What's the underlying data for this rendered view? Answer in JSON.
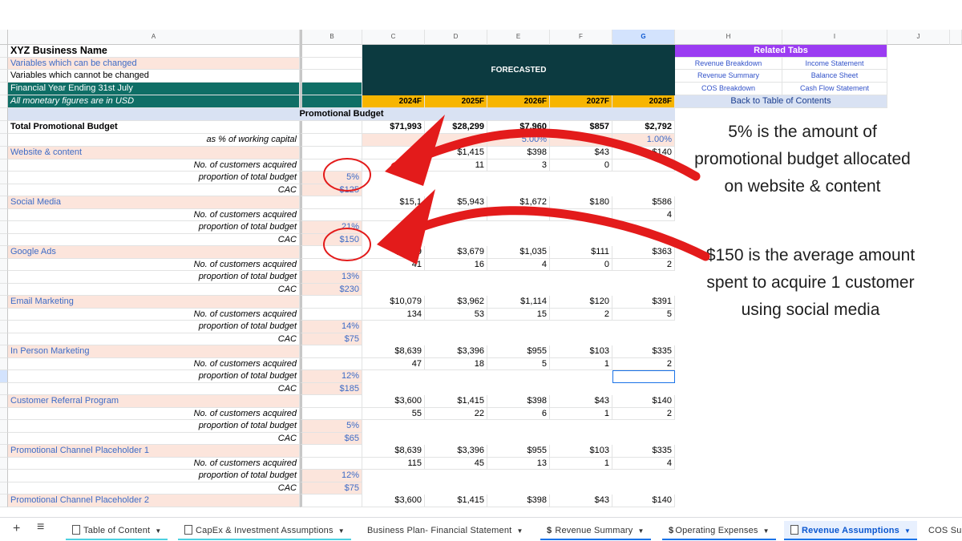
{
  "columns": [
    "A",
    "B",
    "C",
    "D",
    "E",
    "F",
    "G",
    "H",
    "I",
    "J"
  ],
  "sheet": {
    "business_name": "XYZ Business Name",
    "var_changeable": "Variables which can be changed",
    "var_fixed": "Variables which cannot be changed",
    "fy_ending": "Financial Year Ending 31st July",
    "currency_note": "All monetary figures are in USD",
    "forecasted": "FORECASTED",
    "years": [
      "2024F",
      "2025F",
      "2026F",
      "2027F",
      "2028F"
    ],
    "section_title": "Promotional Budget",
    "total_label": "Total Promotional Budget",
    "total_values": [
      "$71,993",
      "$28,299",
      "$7,960",
      "$857",
      "$2,792"
    ],
    "pct_label": "as % of working capital",
    "pct_values": [
      "",
      "",
      "5.00%",
      "",
      "1.00%"
    ],
    "related_title": "Related Tabs",
    "links": [
      [
        "Revenue Breakdown",
        "Income Statement"
      ],
      [
        "Revenue Summary",
        "Balance Sheet"
      ],
      [
        "COS Breakdown",
        "Cash Flow Statement"
      ]
    ],
    "back_link": "Back to Table of Contents",
    "sub_labels": {
      "customers": "No. of customers acquired",
      "proportion": "proportion of total budget",
      "cac": "CAC"
    },
    "channels": [
      {
        "name": "Website & content",
        "budget": [
          "",
          "$1,415",
          "$398",
          "$43",
          "$140"
        ],
        "customers": [
          "",
          "11",
          "3",
          "0",
          ""
        ],
        "proportion": "5%",
        "cac": "$125"
      },
      {
        "name": "Social Media",
        "budget": [
          "$15,1",
          "$5,943",
          "$1,672",
          "$180",
          "$586"
        ],
        "customers": [
          "01",
          "",
          "",
          "",
          "4"
        ],
        "proportion": "21%",
        "cac": "$150"
      },
      {
        "name": "Google Ads",
        "budget": [
          "$9,359",
          "$3,679",
          "$1,035",
          "$111",
          "$363"
        ],
        "customers": [
          "41",
          "16",
          "4",
          "0",
          "2"
        ],
        "proportion": "13%",
        "cac": "$230"
      },
      {
        "name": "Email Marketing",
        "budget": [
          "$10,079",
          "$3,962",
          "$1,114",
          "$120",
          "$391"
        ],
        "customers": [
          "134",
          "53",
          "15",
          "2",
          "5"
        ],
        "proportion": "14%",
        "cac": "$75"
      },
      {
        "name": "In Person Marketing",
        "budget": [
          "$8,639",
          "$3,396",
          "$955",
          "$103",
          "$335"
        ],
        "customers": [
          "47",
          "18",
          "5",
          "1",
          "2"
        ],
        "proportion": "12%",
        "cac": "$185"
      },
      {
        "name": "Customer Referral Program",
        "budget": [
          "$3,600",
          "$1,415",
          "$398",
          "$43",
          "$140"
        ],
        "customers": [
          "55",
          "22",
          "6",
          "1",
          "2"
        ],
        "proportion": "5%",
        "cac": "$65"
      },
      {
        "name": "Promotional Channel Placeholder 1",
        "budget": [
          "$8,639",
          "$3,396",
          "$955",
          "$103",
          "$335"
        ],
        "customers": [
          "115",
          "45",
          "13",
          "1",
          "4"
        ],
        "proportion": "12%",
        "cac": "$75"
      },
      {
        "name": "Promotional Channel Placeholder 2",
        "budget": [
          "$3,600",
          "$1,415",
          "$398",
          "$43",
          "$140"
        ],
        "customers": [
          "",
          "",
          "",
          "",
          ""
        ],
        "proportion": "",
        "cac": ""
      }
    ]
  },
  "annotations": {
    "first": "5% is the amount of promotional budget allocated on website & content",
    "second": "$150 is the average amount spent to acquire 1 customer using social media"
  },
  "tabs": [
    {
      "label": "Table of Content",
      "icon": "document-icon",
      "underline": "#4dd0e1"
    },
    {
      "label": "CapEx & Investment Assumptions",
      "icon": "document-icon",
      "underline": "#4dd0e1"
    },
    {
      "label": "Business Plan- Financial Statement",
      "icon": "",
      "underline": "#ffffff"
    },
    {
      "label": "Revenue Summary",
      "icon": "dollar-icon",
      "underline": "#1a73e8"
    },
    {
      "label": "Operating Expenses",
      "icon": "dollar-icon",
      "underline": "#1a73e8"
    },
    {
      "label": "Revenue Assumptions",
      "icon": "document-icon",
      "underline": "#1a73e8"
    },
    {
      "label": "COS Sur",
      "icon": "",
      "underline": "#ffffff"
    }
  ],
  "colors": {
    "salmon": "#fce5dc",
    "teal": "#0f6e66",
    "forecast_bg": "#0c3a40",
    "year_bg": "#f7b500",
    "related_bg": "#9b3cf2",
    "annotation_red": "#e31b1b"
  }
}
